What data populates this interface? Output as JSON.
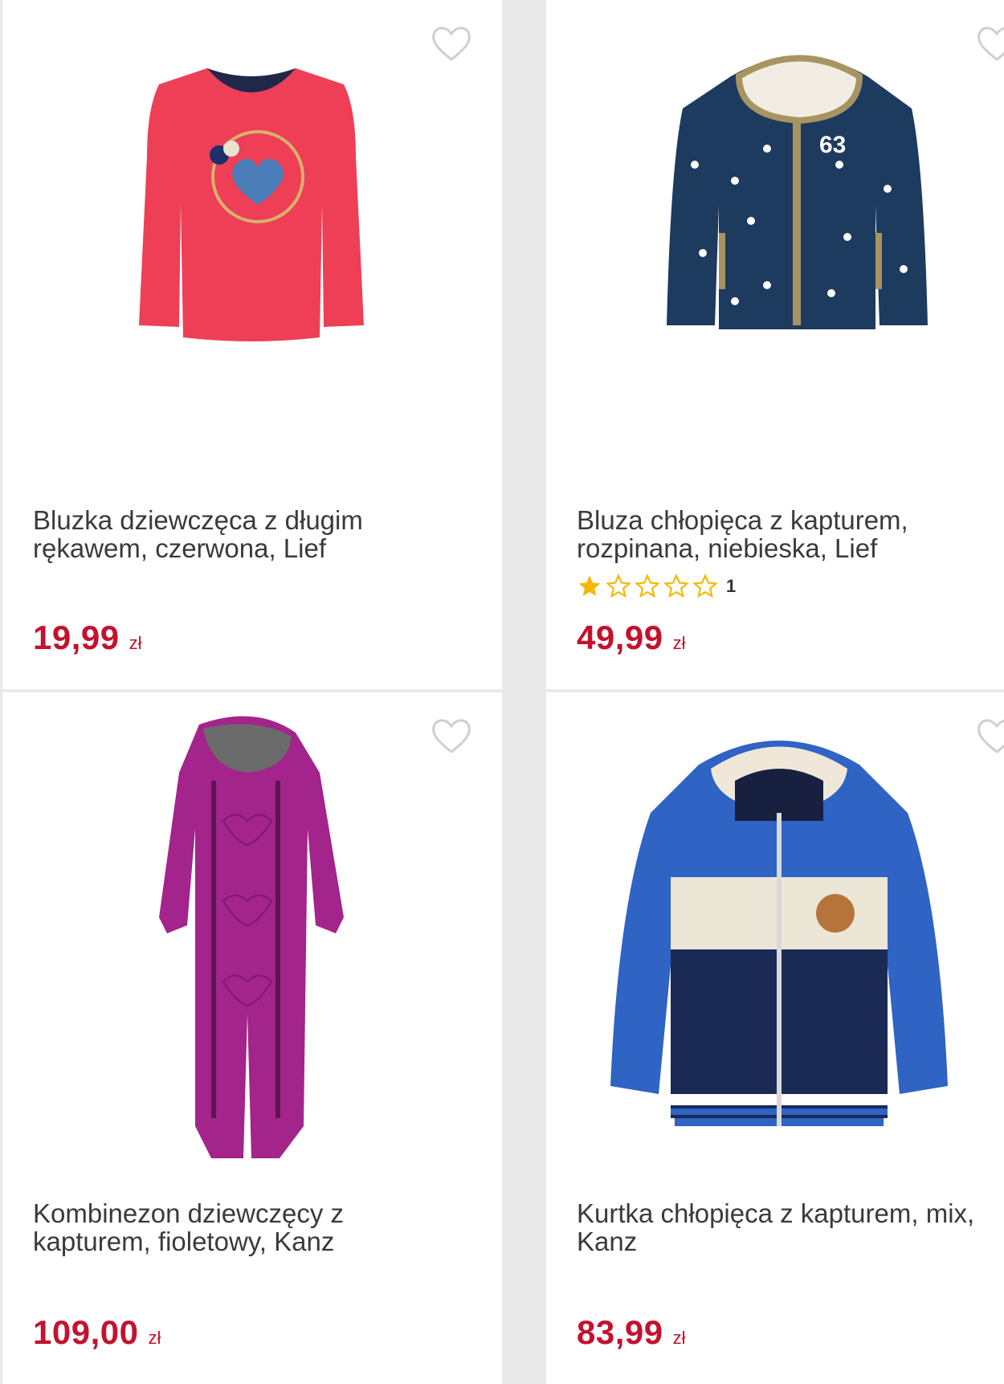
{
  "products": [
    {
      "title": "Bluzka dziewczęca z długim rękawem, czerwona, Lief",
      "price": "19,99",
      "currency": "zł",
      "image_icon": "red-long-sleeve-top-image"
    },
    {
      "title": "Bluza chłopięca z kapturem, rozpinana, niebieska, Lief",
      "price": "49,99",
      "currency": "zł",
      "rating": {
        "stars": 1,
        "max": 5,
        "count": "1"
      },
      "image_icon": "navy-star-hoodie-image"
    },
    {
      "title": "Kombinezon dziewczęcy z kapturem, fioletowy, Kanz",
      "price": "109,00",
      "currency": "zł",
      "image_icon": "purple-snowsuit-image"
    },
    {
      "title": "Kurtka chłopięca z kapturem, mix, Kanz",
      "price": "83,99",
      "currency": "zł",
      "image_icon": "blue-puffer-jacket-image"
    }
  ],
  "colors": {
    "price": "#c3122f",
    "title": "#3a3a3a",
    "star_filled": "#f5b800",
    "star_empty": "#f5b800",
    "heart_outline": "#cfcfcf"
  }
}
